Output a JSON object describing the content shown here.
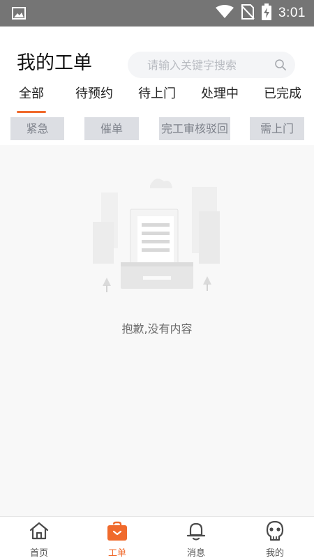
{
  "status_bar": {
    "time": "3:01"
  },
  "header": {
    "title": "我的工单",
    "search": {
      "placeholder": "请输入关键字搜索",
      "value": ""
    }
  },
  "tabs": [
    {
      "label": "全部",
      "active": true
    },
    {
      "label": "待预约",
      "active": false
    },
    {
      "label": "待上门",
      "active": false
    },
    {
      "label": "处理中",
      "active": false
    },
    {
      "label": "已完成",
      "active": false
    }
  ],
  "filters": [
    {
      "label": "紧急"
    },
    {
      "label": "催单"
    },
    {
      "label": "完工审核驳回"
    },
    {
      "label": "需上门"
    }
  ],
  "empty_state": {
    "message": "抱歉,没有内容"
  },
  "bottom_nav": [
    {
      "label": "首页",
      "icon": "home-icon",
      "active": false
    },
    {
      "label": "工单",
      "icon": "briefcase-icon",
      "active": true
    },
    {
      "label": "消息",
      "icon": "bell-icon",
      "active": false
    },
    {
      "label": "我的",
      "icon": "profile-icon",
      "active": false
    }
  ],
  "colors": {
    "accent": "#f06a2c",
    "status_bar": "#757575",
    "chip_bg": "#dcdee3",
    "chip_text": "#7e828b",
    "content_bg": "#f8f8f8"
  }
}
